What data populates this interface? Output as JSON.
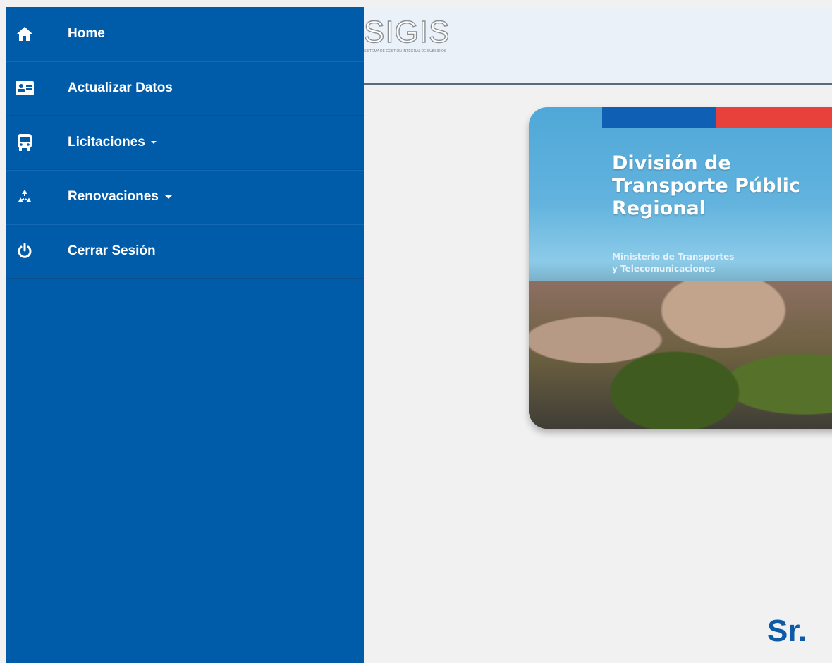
{
  "header": {
    "logo_text": "SIGIS",
    "logo_subtitle": "SISTEMA DE GESTIÓN INTEGRAL DE SUBSIDIOS"
  },
  "sidebar": {
    "items": [
      {
        "label": "Home",
        "icon": "home-icon",
        "has_caret": false
      },
      {
        "label": "Actualizar Datos",
        "icon": "id-card-icon",
        "has_caret": false
      },
      {
        "label": "Licitaciones",
        "icon": "bus-icon",
        "has_caret": true
      },
      {
        "label": "Renovaciones",
        "icon": "recycle-icon",
        "has_caret": true
      },
      {
        "label": "Cerrar Sesión",
        "icon": "power-icon",
        "has_caret": false
      }
    ]
  },
  "banner": {
    "title_line1": "División de",
    "title_line2": "Transporte Públic",
    "title_line3": "Regional",
    "subtitle_line1": "Ministerio de Transportes",
    "subtitle_line2": "y Telecomunicaciones"
  },
  "main": {
    "greeting": "Sr."
  },
  "colors": {
    "sidebar_bg": "#005ba9",
    "header_bg": "#eaf1f8",
    "page_bg": "#f1f1f1",
    "flag_blue": "#0f5fb4",
    "flag_red": "#e8413c"
  }
}
